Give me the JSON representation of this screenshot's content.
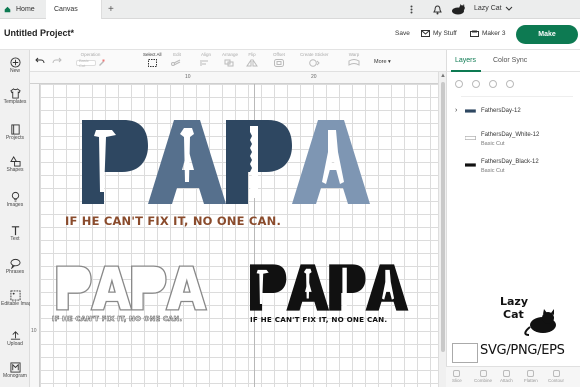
{
  "titlebar": {
    "tabs": [
      {
        "label": "Home"
      },
      {
        "label": "Canvas"
      }
    ],
    "user": {
      "name": "Lazy Cat"
    }
  },
  "header": {
    "project_title": "Untitled Project*",
    "save": "Save",
    "my_stuff": "My Stuff",
    "machine": "Maker 3",
    "make": "Make"
  },
  "left_toolbar": {
    "items": [
      {
        "label": "New",
        "icon": "plus-icon"
      },
      {
        "label": "Templates",
        "icon": "shirt-icon"
      },
      {
        "label": "Projects",
        "icon": "book-icon"
      },
      {
        "label": "Shapes",
        "icon": "shapes-icon"
      },
      {
        "label": "Images",
        "icon": "lightbulb-icon"
      },
      {
        "label": "Text",
        "icon": "text-icon"
      },
      {
        "label": "Phrases",
        "icon": "speech-icon"
      },
      {
        "label": "Editable Images",
        "icon": "editable-image-icon"
      },
      {
        "label": "Upload",
        "icon": "upload-icon"
      },
      {
        "label": "Monogram",
        "icon": "monogram-icon"
      }
    ]
  },
  "edit_toolbar": {
    "operation_label": "Operation",
    "operation_value": "Basic Cut",
    "select_all": "Select All",
    "edit": "Edit",
    "align": "Align",
    "arrange": "Arrange",
    "flip": "Flip",
    "offset": "Offset",
    "create_sticker": "Create Sticker",
    "warp": "Warp",
    "more": "More"
  },
  "rulers": {
    "top": [
      "10",
      "20"
    ],
    "left": [
      "10"
    ]
  },
  "artwork": {
    "main_word": "PAPA",
    "tagline": "IF HE CAN'T FIX IT, NO ONE CAN.",
    "colors": {
      "dark_blue": "#2e4761",
      "mid_blue": "#56708d",
      "light_blue": "#7e96b3",
      "tagline_brown": "#8a4b2c",
      "black": "#111111"
    }
  },
  "right_panel": {
    "tabs": [
      {
        "label": "Layers"
      },
      {
        "label": "Color Sync"
      }
    ],
    "layers": [
      {
        "name": "FathersDay-12",
        "type": ""
      },
      {
        "name": "FathersDay_White-12",
        "type": "Basic Cut"
      },
      {
        "name": "FathersDay_Black-12",
        "type": "Basic Cut"
      }
    ]
  },
  "brand": {
    "name_line1": "Lazy",
    "name_line2": "Cat",
    "formats": "SVG/PNG/EPS"
  },
  "bottom_bar": {
    "items": [
      "Slice",
      "Combine",
      "Attach",
      "Flatten",
      "Contour"
    ]
  },
  "accent_color": "#0d7a52"
}
